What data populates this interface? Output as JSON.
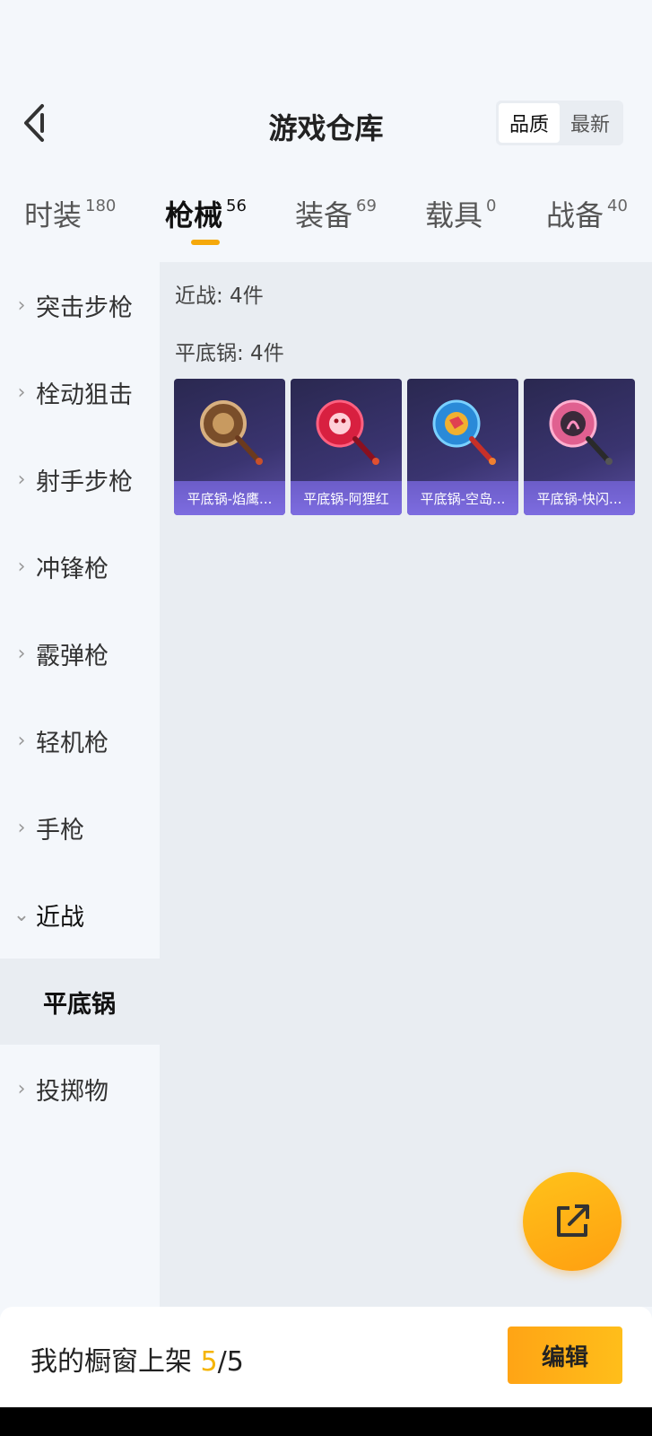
{
  "header": {
    "title": "游戏仓库",
    "sort_options": [
      "品质",
      "最新"
    ],
    "active_sort": "品质"
  },
  "tabs": [
    {
      "label": "时装",
      "count": "180"
    },
    {
      "label": "枪械",
      "count": "56",
      "active": true
    },
    {
      "label": "装备",
      "count": "69"
    },
    {
      "label": "载具",
      "count": "0"
    },
    {
      "label": "战备",
      "count": "40"
    }
  ],
  "sidebar": {
    "items": [
      {
        "label": "突击步枪"
      },
      {
        "label": "栓动狙击"
      },
      {
        "label": "射手步枪"
      },
      {
        "label": "冲锋枪"
      },
      {
        "label": "霰弹枪"
      },
      {
        "label": "轻机枪"
      },
      {
        "label": "手枪"
      },
      {
        "label": "近战",
        "expanded": true
      },
      {
        "label": "平底锅",
        "sub": true,
        "selected": true
      },
      {
        "label": "投掷物"
      }
    ]
  },
  "content": {
    "category_summary": "近战: 4件",
    "subcategory_summary": "平底锅: 4件",
    "items": [
      {
        "name": "平底锅-焰鹰...",
        "icon": "pan-bronze-icon"
      },
      {
        "name": "平底锅-阿狸红",
        "icon": "pan-red-icon"
      },
      {
        "name": "平底锅-空岛...",
        "icon": "pan-blue-icon"
      },
      {
        "name": "平底锅-快闪...",
        "icon": "pan-pink-icon"
      }
    ]
  },
  "fab": {
    "icon": "share-external-icon"
  },
  "footer": {
    "label": "我的橱窗上架 ",
    "count_current": "5",
    "count_separator": "/",
    "count_total": "5",
    "edit_label": "编辑"
  },
  "colors": {
    "accent": "#f5a80a",
    "card_bg": "#3a3470",
    "card_label": "#7d6ce0"
  }
}
